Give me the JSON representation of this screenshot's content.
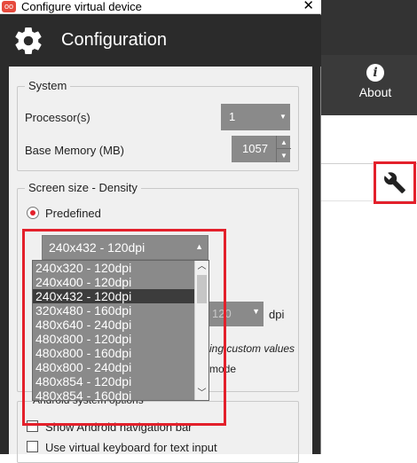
{
  "window": {
    "title": "Configure virtual device",
    "close_glyph": "✕"
  },
  "header": {
    "title": "Configuration",
    "icon": "gear-icon"
  },
  "system": {
    "legend": "System",
    "processors_label": "Processor(s)",
    "processors_value": "1",
    "memory_label": "Base Memory (MB)",
    "memory_value": "1057"
  },
  "screen": {
    "legend": "Screen size - Density",
    "predefined_label": "Predefined",
    "selected": "240x432 - 120dpi",
    "options": [
      "240x320 - 120dpi",
      "240x400 - 120dpi",
      "240x432 - 120dpi",
      "320x480 - 160dpi",
      "480x640 - 240dpi",
      "480x800 - 120dpi",
      "480x800 - 160dpi",
      "480x800 - 240dpi",
      "480x854 - 120dpi",
      "480x854 - 160dpi"
    ],
    "selected_index": 2,
    "dpi_value": "120",
    "dpi_label": "dpi",
    "custom_values_partial": "ing custom values",
    "mode_partial": "mode"
  },
  "android_options": {
    "legend_partial": "Android system options",
    "show_nav_bar": "Show Android navigation bar",
    "virtual_keyboard": "Use virtual keyboard for text input"
  },
  "background_app": {
    "about_label": "About",
    "about_icon": "info-icon",
    "wrench_icon": "wrench-icon"
  },
  "colors": {
    "accent": "#e3202b",
    "dialog_dark": "#2b2b2b",
    "control_gray": "#8a8a8a",
    "selected_item": "#3c3c3c"
  }
}
